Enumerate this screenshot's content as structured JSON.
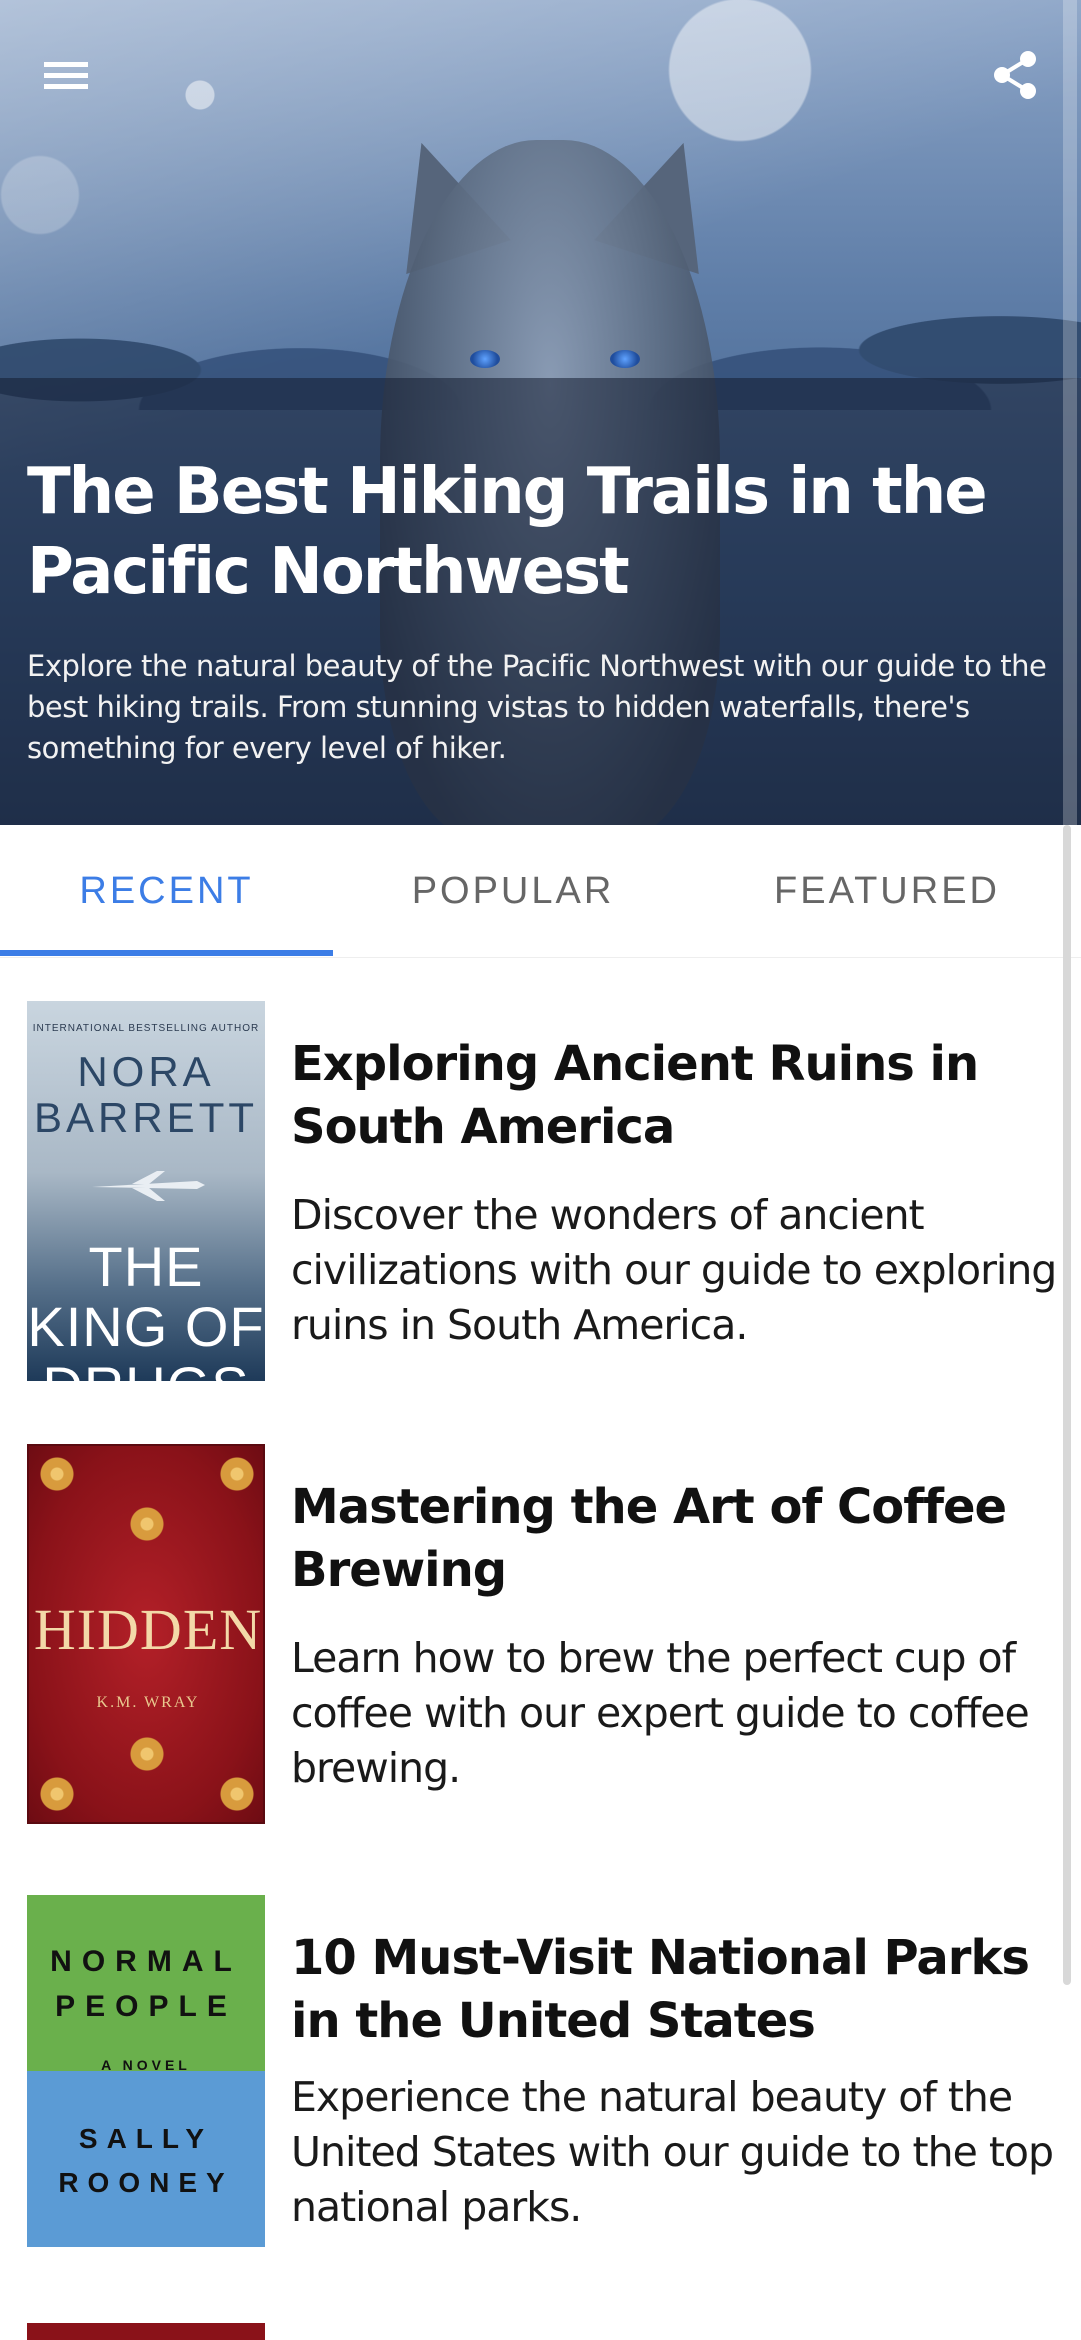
{
  "hero": {
    "title": "The Best Hiking Trails in the Pacific Northwest",
    "description": "Explore the natural beauty of the Pacific Northwest with our guide to the best hiking trails. From stunning vistas to hidden waterfalls, there's something for every level of hiker."
  },
  "icons": {
    "menu": "menu-icon",
    "share": "share-icon"
  },
  "tabs": [
    {
      "label": "RECENT",
      "active": true
    },
    {
      "label": "POPULAR",
      "active": false
    },
    {
      "label": "FEATURED",
      "active": false
    }
  ],
  "colors": {
    "accent": "#3c7de6",
    "tab_inactive": "#666666"
  },
  "articles": [
    {
      "title": "Exploring Ancient Ruins in South America",
      "description": "Discover the wonders of ancient civilizations with our guide to exploring ruins in South America.",
      "cover": {
        "tagline": "INTERNATIONAL BESTSELLING AUTHOR",
        "author": "NORA BARRETT",
        "title": "THE KING OF DRUGS"
      }
    },
    {
      "title": "Mastering the Art of Coffee Brewing",
      "description": "Learn how to brew the perfect cup of coffee with our expert guide to coffee brewing.",
      "cover": {
        "title": "HIDDEN",
        "author": "K.M. WRAY"
      }
    },
    {
      "title": "10 Must-Visit National Parks in the United States",
      "description": "Experience the natural beauty of the United States with our guide to the top national parks.",
      "cover": {
        "title_line1": "NORMAL",
        "title_line2": "PEOPLE",
        "subtitle": "A NOVEL",
        "author_line1": "SALLY",
        "author_line2": "ROONEY"
      }
    }
  ]
}
